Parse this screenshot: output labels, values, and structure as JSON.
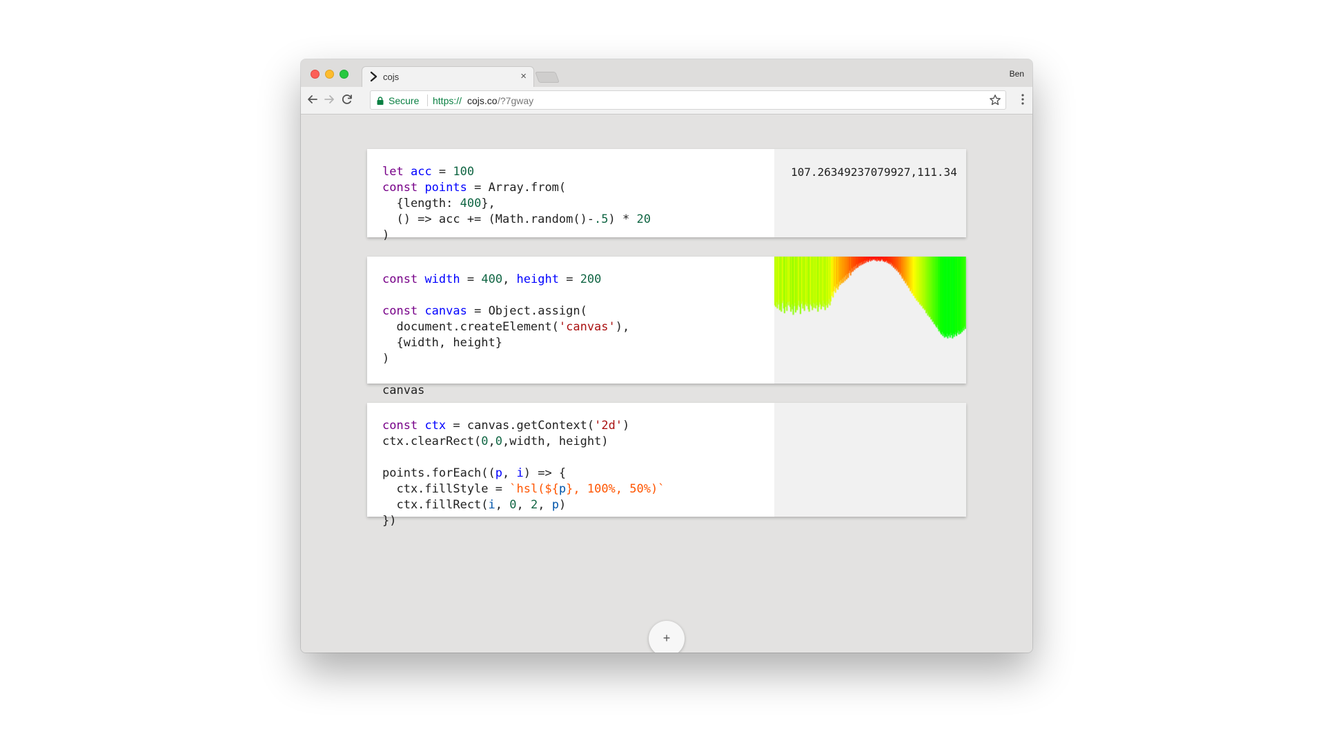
{
  "browser": {
    "tab_title": "cojs",
    "tab_close": "×",
    "profile_name": "Ben",
    "secure_label": "Secure",
    "url_scheme": "https://",
    "url_host": "cojs.co",
    "url_path": "/?7gway"
  },
  "cells": [
    {
      "code_lines": [
        [
          {
            "t": "let",
            "c": "k"
          },
          {
            "t": " "
          },
          {
            "t": "acc",
            "c": "d"
          },
          {
            "t": " = "
          },
          {
            "t": "100",
            "c": "n"
          }
        ],
        [
          {
            "t": "const",
            "c": "k"
          },
          {
            "t": " "
          },
          {
            "t": "points",
            "c": "d"
          },
          {
            "t": " = Array.from("
          }
        ],
        [
          {
            "t": "  {length: "
          },
          {
            "t": "400",
            "c": "n"
          },
          {
            "t": "},"
          }
        ],
        [
          {
            "t": "  () => acc += (Math.random()-"
          },
          {
            "t": ".5",
            "c": "n"
          },
          {
            "t": ") * "
          },
          {
            "t": "20",
            "c": "n"
          }
        ],
        [
          {
            "t": ")"
          }
        ]
      ],
      "output_text": "107.26349237079927,111.34"
    },
    {
      "code_lines": [
        [
          {
            "t": "const",
            "c": "k"
          },
          {
            "t": " "
          },
          {
            "t": "width",
            "c": "d"
          },
          {
            "t": " = "
          },
          {
            "t": "400",
            "c": "n"
          },
          {
            "t": ", "
          },
          {
            "t": "height",
            "c": "d"
          },
          {
            "t": " = "
          },
          {
            "t": "200",
            "c": "n"
          }
        ],
        [],
        [
          {
            "t": "const",
            "c": "k"
          },
          {
            "t": " "
          },
          {
            "t": "canvas",
            "c": "d"
          },
          {
            "t": " = Object.assign("
          }
        ],
        [
          {
            "t": "  document.createElement("
          },
          {
            "t": "'canvas'",
            "c": "s"
          },
          {
            "t": "),"
          }
        ],
        [
          {
            "t": "  {width, height}"
          }
        ],
        [
          {
            "t": ")"
          }
        ],
        [],
        [
          {
            "t": "canvas"
          }
        ]
      ]
    },
    {
      "code_lines": [
        [
          {
            "t": "const",
            "c": "k"
          },
          {
            "t": " "
          },
          {
            "t": "ctx",
            "c": "d"
          },
          {
            "t": " = canvas.getContext("
          },
          {
            "t": "'2d'",
            "c": "s"
          },
          {
            "t": ")"
          }
        ],
        [
          {
            "t": "ctx.clearRect("
          },
          {
            "t": "0",
            "c": "n"
          },
          {
            "t": ","
          },
          {
            "t": "0",
            "c": "n"
          },
          {
            "t": ",width, height)"
          }
        ],
        [],
        [
          {
            "t": "points.forEach(("
          },
          {
            "t": "p",
            "c": "d"
          },
          {
            "t": ", "
          },
          {
            "t": "i",
            "c": "d"
          },
          {
            "t": ") => {"
          }
        ],
        [
          {
            "t": "  ctx.fillStyle = "
          },
          {
            "t": "`hsl(${",
            "c": "t"
          },
          {
            "t": "p",
            "c": "v"
          },
          {
            "t": "}, 100%, 50%)`",
            "c": "t"
          }
        ],
        [
          {
            "t": "  ctx.fillRect("
          },
          {
            "t": "i",
            "c": "v"
          },
          {
            "t": ", "
          },
          {
            "t": "0",
            "c": "n"
          },
          {
            "t": ", "
          },
          {
            "t": "2",
            "c": "n"
          },
          {
            "t": ", "
          },
          {
            "t": "p",
            "c": "v"
          },
          {
            "t": ")"
          }
        ],
        [
          {
            "t": "})"
          }
        ]
      ]
    }
  ],
  "add_cell_label": "+",
  "canvas_values": [
    62,
    64,
    58,
    66,
    61,
    55,
    68,
    63,
    70,
    59,
    56,
    66,
    72,
    64,
    60,
    69,
    58,
    62,
    57,
    64,
    70,
    61,
    67,
    74,
    63,
    59,
    71,
    65,
    68,
    62,
    56,
    64,
    73,
    60,
    57,
    66,
    62,
    69,
    61,
    58,
    63,
    60,
    67,
    70,
    61,
    55,
    63,
    68,
    59,
    65,
    60,
    66,
    58,
    62,
    70,
    64,
    58,
    61,
    67,
    63,
    56,
    64,
    60,
    68,
    62,
    57,
    65,
    60,
    54,
    62,
    57,
    50,
    45,
    52,
    44,
    38,
    46,
    40,
    35,
    42,
    38,
    32,
    36,
    30,
    34,
    28,
    33,
    26,
    31,
    24,
    29,
    22,
    27,
    21,
    18,
    24,
    20,
    15,
    19,
    13,
    17,
    12,
    15,
    10,
    14,
    9,
    12,
    8,
    11,
    7,
    10,
    6,
    9,
    5,
    8,
    6,
    4,
    7,
    5,
    3,
    6,
    4,
    5,
    3,
    4,
    3,
    5,
    4,
    6,
    3,
    5,
    4,
    6,
    5,
    3,
    4,
    6,
    5,
    7,
    6,
    5,
    8,
    6,
    9,
    7,
    10,
    8,
    12,
    10,
    14,
    12,
    16,
    14,
    18,
    16,
    20,
    19,
    23,
    21,
    25,
    28,
    26,
    31,
    29,
    34,
    32,
    37,
    36,
    40,
    39,
    44,
    42,
    47,
    46,
    50,
    49,
    53,
    52,
    56,
    55,
    58,
    57,
    61,
    60,
    63,
    62,
    66,
    65,
    68,
    67,
    72,
    70,
    75,
    73,
    77,
    76,
    80,
    79,
    83,
    82,
    86,
    84,
    88,
    90,
    87,
    92,
    95,
    93,
    97,
    99,
    96,
    101,
    98,
    103,
    100,
    102,
    98,
    104,
    101,
    99,
    103,
    97,
    100,
    104,
    98,
    102,
    99,
    96,
    101,
    97,
    94,
    99,
    95,
    98,
    93,
    96,
    91,
    94,
    89,
    92
  ]
}
